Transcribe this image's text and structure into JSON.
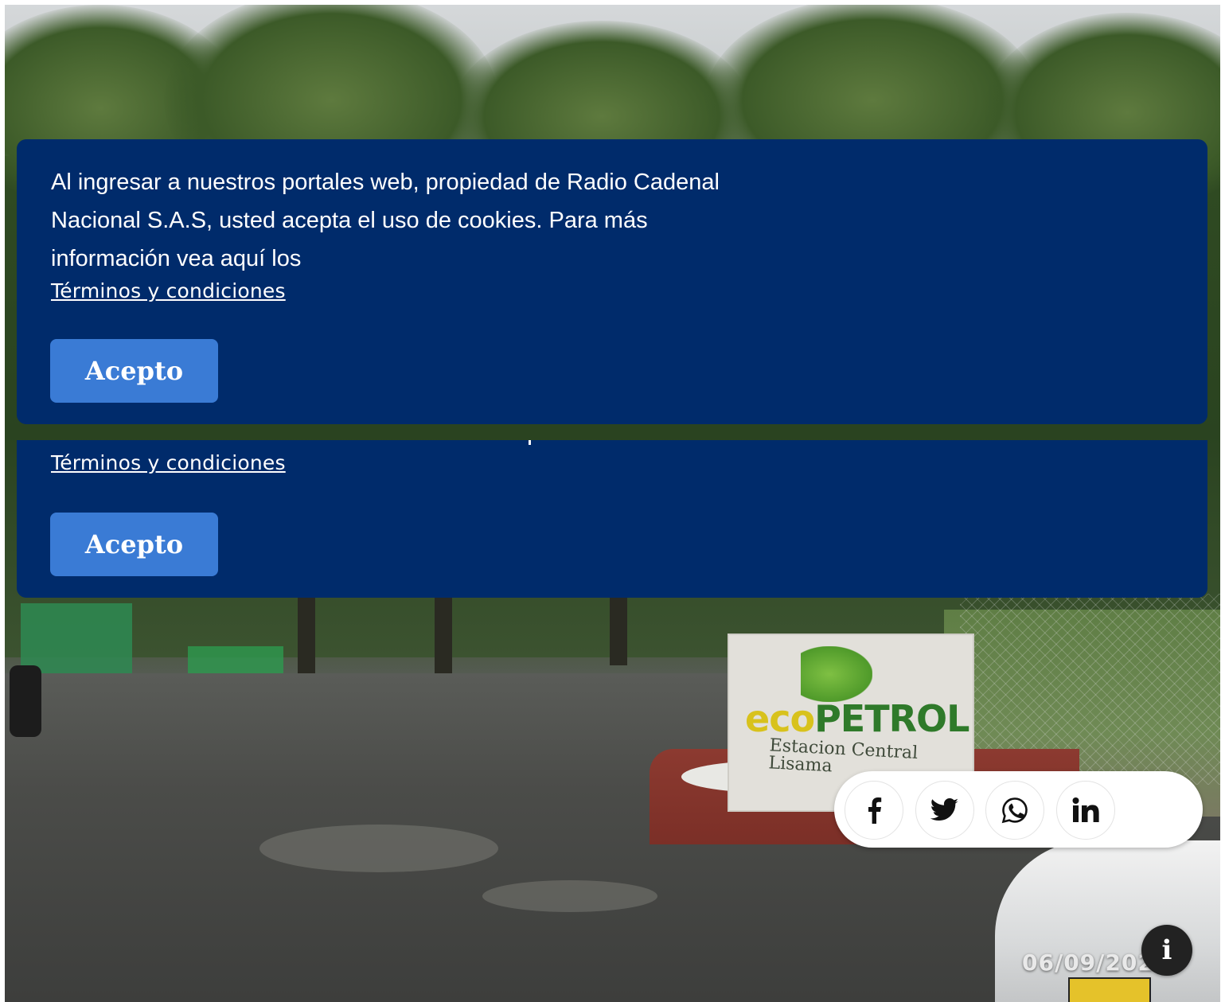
{
  "cookie_banner": {
    "message": "Al ingresar a nuestros portales web, propiedad de Radio Cadenal Nacional S.A.S, usted acepta el uso de cookies. Para más información vea aquí los",
    "terms_link": "Términos y condiciones",
    "accept_label": "Acepto"
  },
  "cookie_banner_duplicate": {
    "terms_link": "Términos y condiciones",
    "accept_label": "Acepto"
  },
  "photo": {
    "sign_brand_part1": "eco",
    "sign_brand_part2": "PETROL",
    "sign_subtitle": "Estacion Central Lisama"
  },
  "share": {
    "icons": [
      "facebook-icon",
      "twitter-icon",
      "whatsapp-icon",
      "linkedin-icon"
    ]
  },
  "caption": {
    "date": "06/09/202"
  },
  "info_button": {
    "label": "i"
  },
  "colors": {
    "banner": "#002b6b",
    "accept_button": "#3a7bd5",
    "share_bar": "#ffffff"
  }
}
